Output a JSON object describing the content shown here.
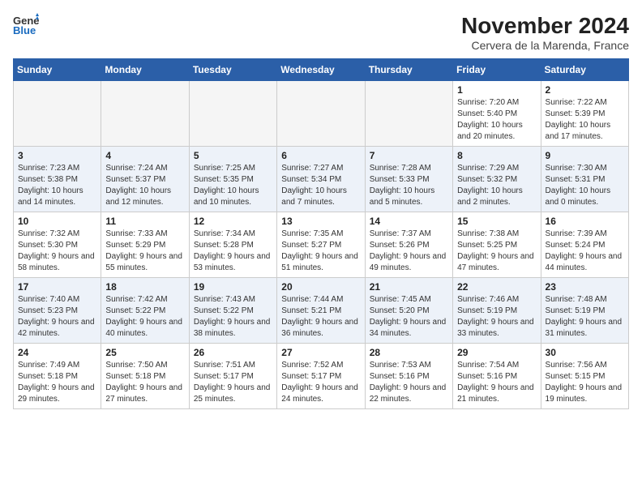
{
  "header": {
    "logo_general": "General",
    "logo_blue": "Blue",
    "title": "November 2024",
    "subtitle": "Cervera de la Marenda, France"
  },
  "weekdays": [
    "Sunday",
    "Monday",
    "Tuesday",
    "Wednesday",
    "Thursday",
    "Friday",
    "Saturday"
  ],
  "weeks": [
    [
      {
        "day": "",
        "info": ""
      },
      {
        "day": "",
        "info": ""
      },
      {
        "day": "",
        "info": ""
      },
      {
        "day": "",
        "info": ""
      },
      {
        "day": "",
        "info": ""
      },
      {
        "day": "1",
        "info": "Sunrise: 7:20 AM\nSunset: 5:40 PM\nDaylight: 10 hours and 20 minutes."
      },
      {
        "day": "2",
        "info": "Sunrise: 7:22 AM\nSunset: 5:39 PM\nDaylight: 10 hours and 17 minutes."
      }
    ],
    [
      {
        "day": "3",
        "info": "Sunrise: 7:23 AM\nSunset: 5:38 PM\nDaylight: 10 hours and 14 minutes."
      },
      {
        "day": "4",
        "info": "Sunrise: 7:24 AM\nSunset: 5:37 PM\nDaylight: 10 hours and 12 minutes."
      },
      {
        "day": "5",
        "info": "Sunrise: 7:25 AM\nSunset: 5:35 PM\nDaylight: 10 hours and 10 minutes."
      },
      {
        "day": "6",
        "info": "Sunrise: 7:27 AM\nSunset: 5:34 PM\nDaylight: 10 hours and 7 minutes."
      },
      {
        "day": "7",
        "info": "Sunrise: 7:28 AM\nSunset: 5:33 PM\nDaylight: 10 hours and 5 minutes."
      },
      {
        "day": "8",
        "info": "Sunrise: 7:29 AM\nSunset: 5:32 PM\nDaylight: 10 hours and 2 minutes."
      },
      {
        "day": "9",
        "info": "Sunrise: 7:30 AM\nSunset: 5:31 PM\nDaylight: 10 hours and 0 minutes."
      }
    ],
    [
      {
        "day": "10",
        "info": "Sunrise: 7:32 AM\nSunset: 5:30 PM\nDaylight: 9 hours and 58 minutes."
      },
      {
        "day": "11",
        "info": "Sunrise: 7:33 AM\nSunset: 5:29 PM\nDaylight: 9 hours and 55 minutes."
      },
      {
        "day": "12",
        "info": "Sunrise: 7:34 AM\nSunset: 5:28 PM\nDaylight: 9 hours and 53 minutes."
      },
      {
        "day": "13",
        "info": "Sunrise: 7:35 AM\nSunset: 5:27 PM\nDaylight: 9 hours and 51 minutes."
      },
      {
        "day": "14",
        "info": "Sunrise: 7:37 AM\nSunset: 5:26 PM\nDaylight: 9 hours and 49 minutes."
      },
      {
        "day": "15",
        "info": "Sunrise: 7:38 AM\nSunset: 5:25 PM\nDaylight: 9 hours and 47 minutes."
      },
      {
        "day": "16",
        "info": "Sunrise: 7:39 AM\nSunset: 5:24 PM\nDaylight: 9 hours and 44 minutes."
      }
    ],
    [
      {
        "day": "17",
        "info": "Sunrise: 7:40 AM\nSunset: 5:23 PM\nDaylight: 9 hours and 42 minutes."
      },
      {
        "day": "18",
        "info": "Sunrise: 7:42 AM\nSunset: 5:22 PM\nDaylight: 9 hours and 40 minutes."
      },
      {
        "day": "19",
        "info": "Sunrise: 7:43 AM\nSunset: 5:22 PM\nDaylight: 9 hours and 38 minutes."
      },
      {
        "day": "20",
        "info": "Sunrise: 7:44 AM\nSunset: 5:21 PM\nDaylight: 9 hours and 36 minutes."
      },
      {
        "day": "21",
        "info": "Sunrise: 7:45 AM\nSunset: 5:20 PM\nDaylight: 9 hours and 34 minutes."
      },
      {
        "day": "22",
        "info": "Sunrise: 7:46 AM\nSunset: 5:19 PM\nDaylight: 9 hours and 33 minutes."
      },
      {
        "day": "23",
        "info": "Sunrise: 7:48 AM\nSunset: 5:19 PM\nDaylight: 9 hours and 31 minutes."
      }
    ],
    [
      {
        "day": "24",
        "info": "Sunrise: 7:49 AM\nSunset: 5:18 PM\nDaylight: 9 hours and 29 minutes."
      },
      {
        "day": "25",
        "info": "Sunrise: 7:50 AM\nSunset: 5:18 PM\nDaylight: 9 hours and 27 minutes."
      },
      {
        "day": "26",
        "info": "Sunrise: 7:51 AM\nSunset: 5:17 PM\nDaylight: 9 hours and 25 minutes."
      },
      {
        "day": "27",
        "info": "Sunrise: 7:52 AM\nSunset: 5:17 PM\nDaylight: 9 hours and 24 minutes."
      },
      {
        "day": "28",
        "info": "Sunrise: 7:53 AM\nSunset: 5:16 PM\nDaylight: 9 hours and 22 minutes."
      },
      {
        "day": "29",
        "info": "Sunrise: 7:54 AM\nSunset: 5:16 PM\nDaylight: 9 hours and 21 minutes."
      },
      {
        "day": "30",
        "info": "Sunrise: 7:56 AM\nSunset: 5:15 PM\nDaylight: 9 hours and 19 minutes."
      }
    ]
  ]
}
